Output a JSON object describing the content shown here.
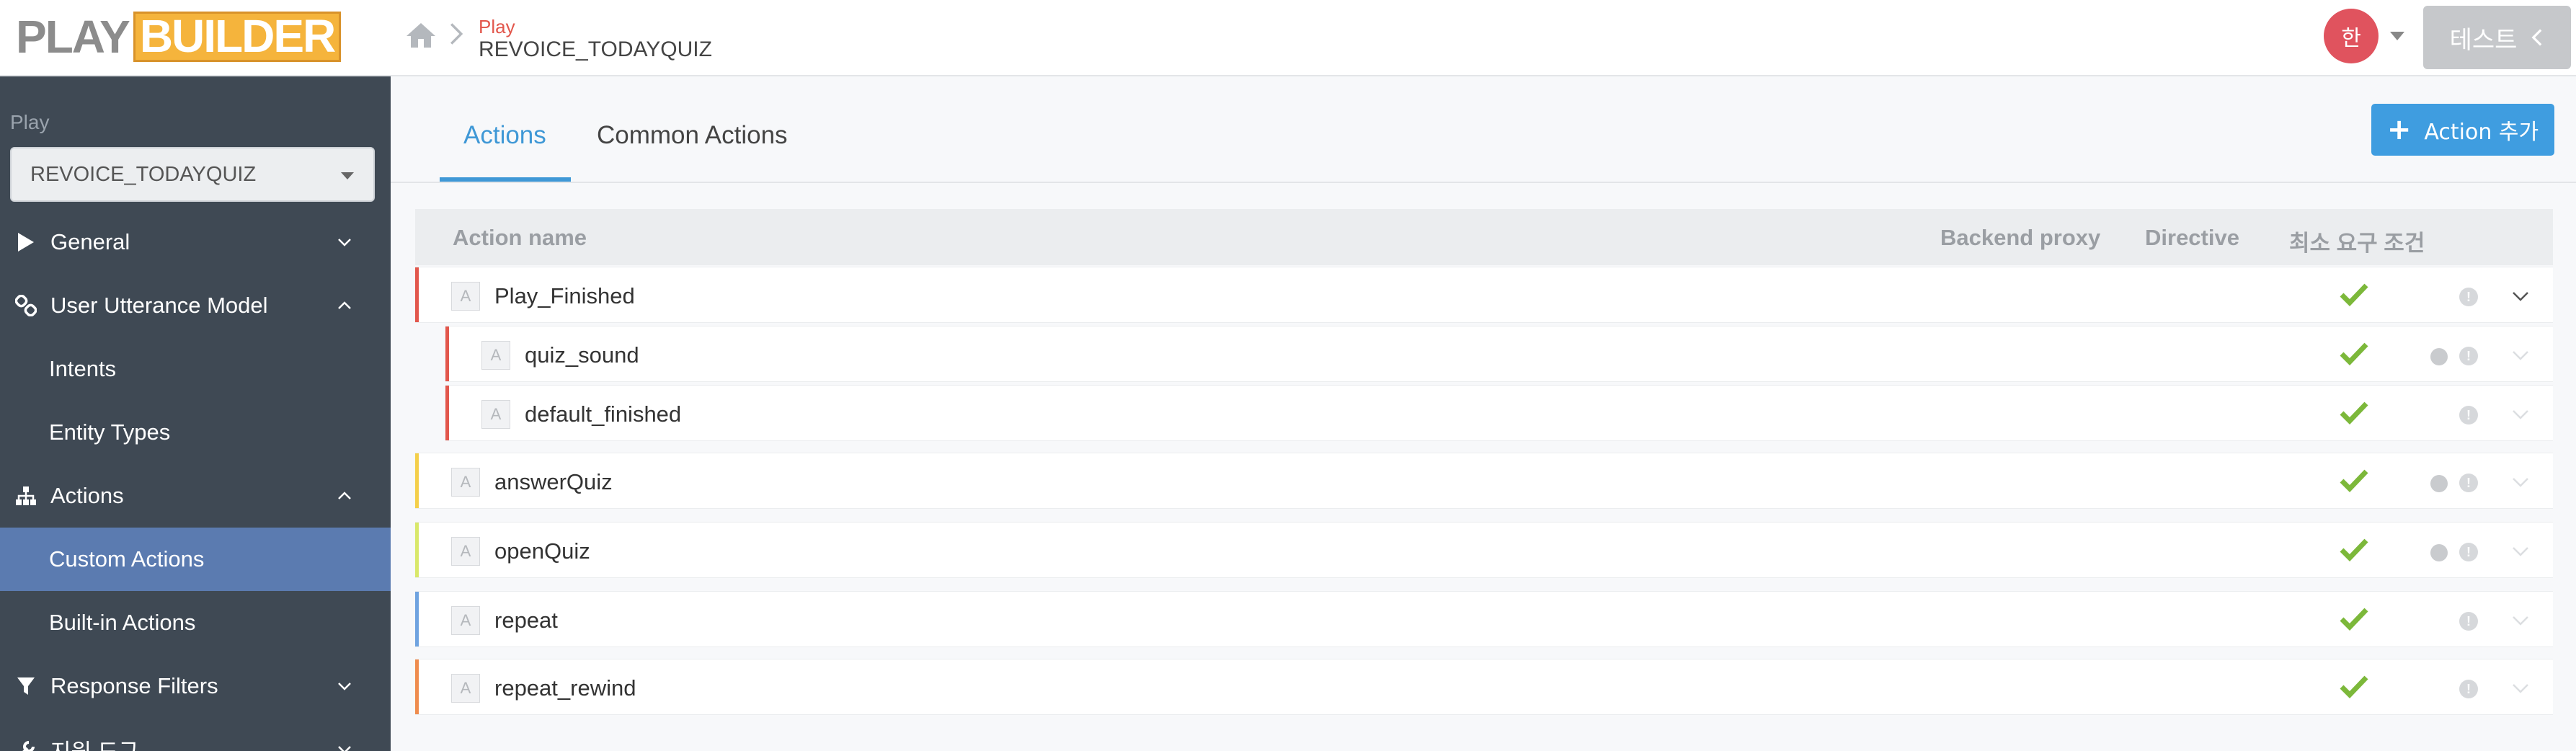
{
  "header": {
    "logo_play": "PLAY",
    "logo_builder": "BUILDER",
    "breadcrumb_top": "Play",
    "breadcrumb_current": "REVOICE_TODAYQUIZ",
    "avatar_text": "한",
    "test_button_label": "테스트"
  },
  "sidebar": {
    "play_label": "Play",
    "play_select_value": "REVOICE_TODAYQUIZ",
    "items": [
      {
        "label": "General",
        "icon": "play-triangle-icon",
        "expanded": false
      },
      {
        "label": "User Utterance Model",
        "icon": "link-icon",
        "expanded": true
      },
      {
        "label": "Intents"
      },
      {
        "label": "Entity Types"
      },
      {
        "label": "Actions",
        "icon": "sitemap-icon",
        "expanded": true
      },
      {
        "label": "Custom Actions",
        "active": true
      },
      {
        "label": "Built-in Actions"
      },
      {
        "label": "Response Filters",
        "icon": "filter-icon",
        "expanded": false
      },
      {
        "label": "지원 도구",
        "icon": "wrench-icon",
        "expanded": false
      }
    ]
  },
  "main": {
    "tabs": [
      {
        "label": "Actions",
        "active": true
      },
      {
        "label": "Common Actions",
        "active": false
      }
    ],
    "add_button_label": "Action 추가",
    "table": {
      "columns": [
        "Action name",
        "Backend proxy",
        "Directive",
        "최소 요구 조건"
      ],
      "rows": [
        {
          "badge": "A",
          "name": "Play_Finished",
          "backend_proxy": false,
          "requirement_met": true,
          "color": "#e2574c"
        },
        {
          "badge": "A",
          "name": "quiz_sound",
          "backend_proxy": true,
          "requirement_met": true,
          "color": "#e2574c"
        },
        {
          "badge": "A",
          "name": "default_finished",
          "backend_proxy": false,
          "requirement_met": true,
          "color": "#e2574c"
        },
        {
          "badge": "A",
          "name": "answerQuiz",
          "backend_proxy": true,
          "requirement_met": true,
          "color": "#f4cf4a"
        },
        {
          "badge": "A",
          "name": "openQuiz",
          "backend_proxy": true,
          "requirement_met": true,
          "color": "#d9e86a"
        },
        {
          "badge": "A",
          "name": "repeat",
          "backend_proxy": false,
          "requirement_met": true,
          "color": "#6fa3e0"
        },
        {
          "badge": "A",
          "name": "repeat_rewind",
          "backend_proxy": false,
          "requirement_met": true,
          "color": "#ef8c4e"
        }
      ]
    }
  },
  "colors": {
    "accent_blue": "#3f98d6",
    "sidebar_bg": "#3f4954",
    "sidebar_active": "#5b7bb0",
    "check_green": "#7cb83a",
    "logo_orange": "#f5b43c"
  }
}
